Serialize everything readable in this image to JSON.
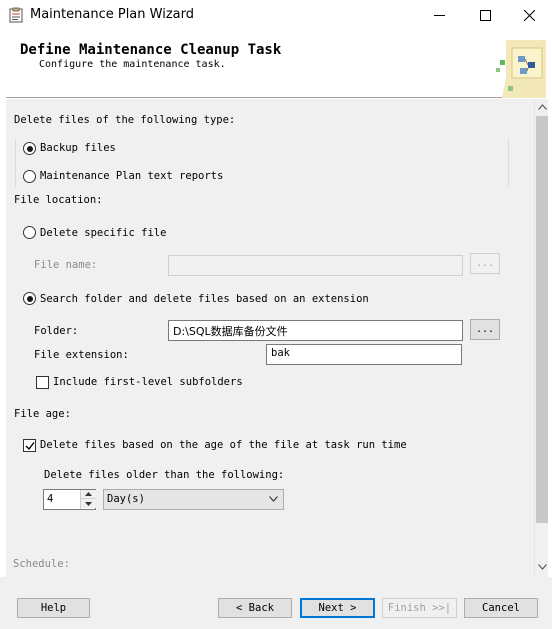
{
  "window": {
    "title": "Maintenance Plan Wizard",
    "controls": [
      "minimize-icon",
      "maximize-icon",
      "close-icon"
    ]
  },
  "header": {
    "title": "Define Maintenance Cleanup Task",
    "subtitle": "Configure the maintenance task."
  },
  "delete_type": {
    "label": "Delete files of the following type:",
    "options": [
      {
        "label": "Backup files",
        "selected": true
      },
      {
        "label": "Maintenance Plan text reports",
        "selected": false
      }
    ]
  },
  "file_location": {
    "label": "File location:",
    "specific_file": {
      "label": "Delete specific file",
      "selected": false,
      "file_name_label": "File name:",
      "file_name_value": "",
      "browse_label": "..."
    },
    "search_folder": {
      "label": "Search folder and delete files based on an extension",
      "selected": true,
      "folder_label": "Folder:",
      "folder_value": "D:\\SQL数据库备份文件",
      "browse_label": "...",
      "extension_label": "File extension:",
      "extension_value": "bak",
      "subfolders_label": "Include first-level subfolders",
      "subfolders_checked": false
    }
  },
  "file_age": {
    "label": "File age:",
    "delete_by_age_label": "Delete files based on the age of the file at task run time",
    "delete_by_age_checked": true,
    "older_than_label": "Delete files older than the following:",
    "amount": "4",
    "unit": "Day(s)"
  },
  "schedule": {
    "label": "Schedule:"
  },
  "footer": {
    "help": "Help",
    "back": "< Back",
    "next": "Next >",
    "finish": "Finish >>|",
    "cancel": "Cancel"
  },
  "colors": {
    "accent": "#0078d7",
    "panel": "#f0f0f0",
    "disabled_text": "#a0a0a0"
  }
}
